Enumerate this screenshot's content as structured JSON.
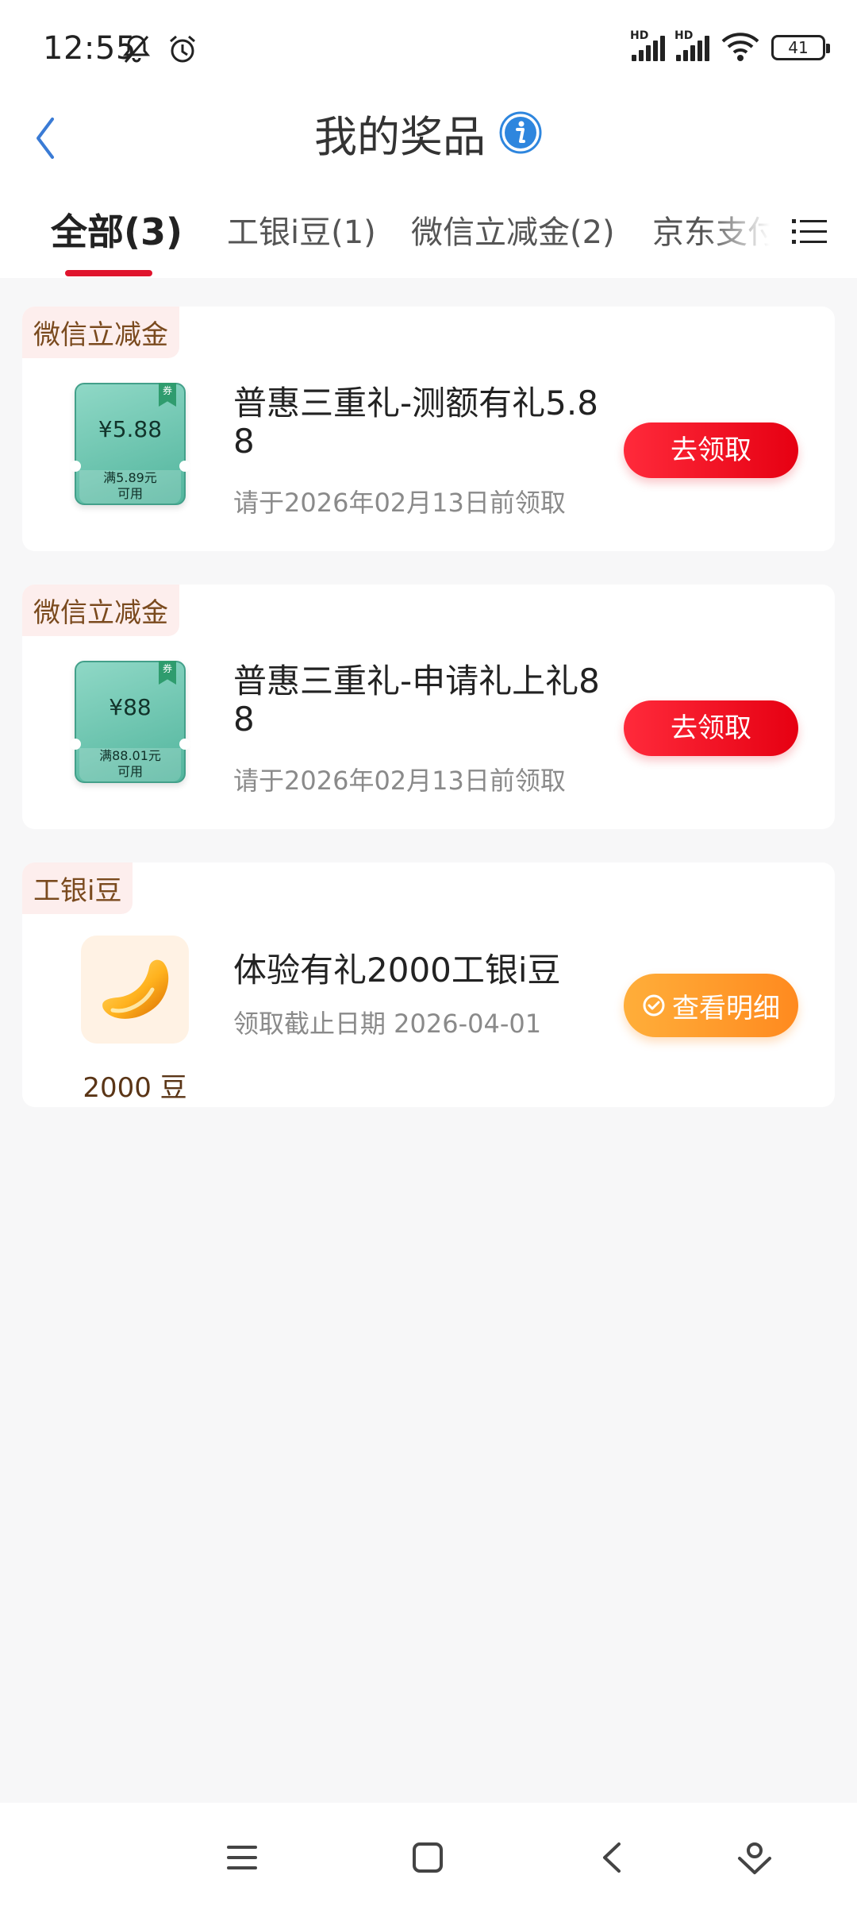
{
  "status_bar": {
    "time": "12:55",
    "left_icons": [
      "mute-bell-icon",
      "alarm-icon"
    ],
    "right_icons": [
      "hd-signal-icon",
      "hd-signal-icon",
      "wifi-icon",
      "battery-icon"
    ],
    "battery": "41"
  },
  "header": {
    "title": "我的奖品",
    "back_icon": "chevron-left-icon",
    "info_icon": "info-icon"
  },
  "tabs": [
    {
      "label": "全部(3)",
      "active": true
    },
    {
      "label": "工银i豆(1)",
      "active": false
    },
    {
      "label": "微信立减金(2)",
      "active": false
    },
    {
      "label": "京东支付",
      "active": false
    }
  ],
  "tab_menu_icon": "list-menu-icon",
  "cards": [
    {
      "tag": "微信立减金",
      "coupon_amount": "¥5.88",
      "coupon_condition_1": "满5.89元",
      "coupon_condition_2": "可用",
      "coupon_flag": "券",
      "title_line1": "普惠三重礼-测额有礼5.8",
      "title_line2": "8",
      "subtitle": "请于2026年02月13日前领取",
      "button": "去领取"
    },
    {
      "tag": "微信立减金",
      "coupon_amount": "¥88",
      "coupon_condition_1": "满88.01元",
      "coupon_condition_2": "可用",
      "coupon_flag": "券",
      "title_line1": "普惠三重礼-申请礼上礼8",
      "title_line2": "8",
      "subtitle": "请于2026年02月13日前领取",
      "button": "去领取"
    },
    {
      "tag": "工银i豆",
      "image_icon": "bean-icon",
      "caption": "2000 豆",
      "title": "体验有礼2000工银i豆",
      "subtitle": "领取截止日期 2026-04-01",
      "button": "查看明细",
      "button_icon": "check-circle-icon"
    }
  ],
  "system_nav": [
    "menu-icon",
    "home-square-icon",
    "back-chevron-icon",
    "assistant-icon"
  ],
  "colors": {
    "accent_red": "#e60012",
    "accent_orange": "#ff8a1f",
    "tag_bg": "#fdeeed",
    "tag_text": "#7a4a1e",
    "page_bg": "#f7f7f8"
  }
}
